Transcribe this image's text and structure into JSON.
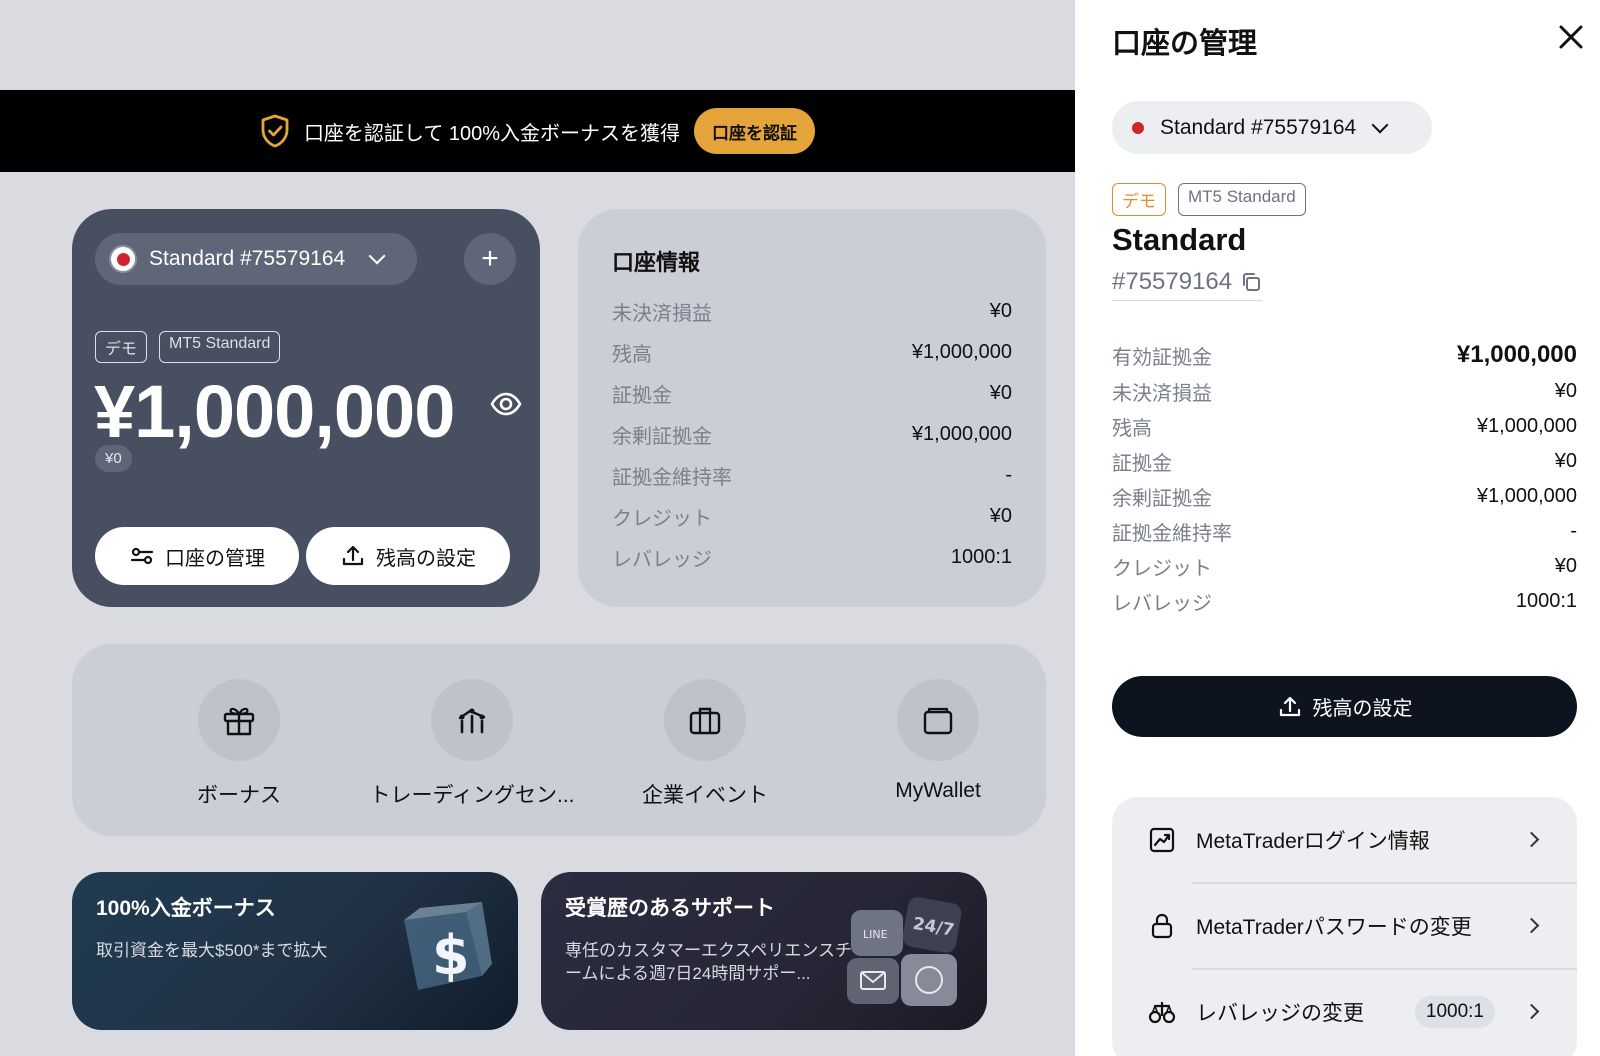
{
  "banner": {
    "text": "口座を認証して 100%入金ボーナスを獲得",
    "button": "口座を認証"
  },
  "account_card": {
    "account_label": "Standard #75579164",
    "tag_demo": "デモ",
    "tag_type": "MT5 Standard",
    "balance": "¥1,000,000",
    "sub_balance": "¥0",
    "manage_button": "口座の管理",
    "set_balance_button": "残高の設定"
  },
  "info_card": {
    "title": "口座情報",
    "rows": [
      {
        "label": "未決済損益",
        "value": "¥0"
      },
      {
        "label": "残高",
        "value": "¥1,000,000"
      },
      {
        "label": "証拠金",
        "value": "¥0"
      },
      {
        "label": "余剰証拠金",
        "value": "¥1,000,000"
      },
      {
        "label": "証拠金維持率",
        "value": "-"
      },
      {
        "label": "クレジット",
        "value": "¥0"
      },
      {
        "label": "レバレッジ",
        "value": "1000:1"
      }
    ]
  },
  "quick_actions": [
    {
      "label": "ボーナス",
      "icon": "gift-icon"
    },
    {
      "label": "トレーディングセン...",
      "icon": "chart-bars-icon"
    },
    {
      "label": "企業イベント",
      "icon": "briefcase-icon"
    },
    {
      "label": "MyWallet",
      "icon": "wallet-icon"
    }
  ],
  "promos": [
    {
      "title": "100%入金ボーナス",
      "text": "取引資金を最大$500*まで拡大"
    },
    {
      "title": "受賞歴のあるサポート",
      "text": "専任のカスタマーエクスペリエンスチームによる週7日24時間サポー..."
    }
  ],
  "panel": {
    "title": "口座の管理",
    "account_label": "Standard #75579164",
    "tag_demo": "デモ",
    "tag_type": "MT5 Standard",
    "name": "Standard",
    "number": "#75579164",
    "rows": [
      {
        "label": "有効証拠金",
        "value": "¥1,000,000"
      },
      {
        "label": "未決済損益",
        "value": "¥0"
      },
      {
        "label": "残高",
        "value": "¥1,000,000"
      },
      {
        "label": "証拠金",
        "value": "¥0"
      },
      {
        "label": "余剰証拠金",
        "value": "¥1,000,000"
      },
      {
        "label": "証拠金維持率",
        "value": "-"
      },
      {
        "label": "クレジット",
        "value": "¥0"
      },
      {
        "label": "レバレッジ",
        "value": "1000:1"
      }
    ],
    "set_balance_button": "残高の設定",
    "menu": [
      {
        "label": "MetaTraderログイン情報",
        "icon": "chart-login-icon"
      },
      {
        "label": "MetaTraderパスワードの変更",
        "icon": "lock-icon"
      },
      {
        "label": "レバレッジの変更",
        "icon": "scale-icon",
        "badge": "1000:1"
      }
    ]
  },
  "colors": {
    "banner_button": "#e5a43a",
    "card_dark": "#474f61",
    "panel_button": "#0d1420",
    "demo_tag": "#e38a2c",
    "flag_red": "#d1242c"
  }
}
